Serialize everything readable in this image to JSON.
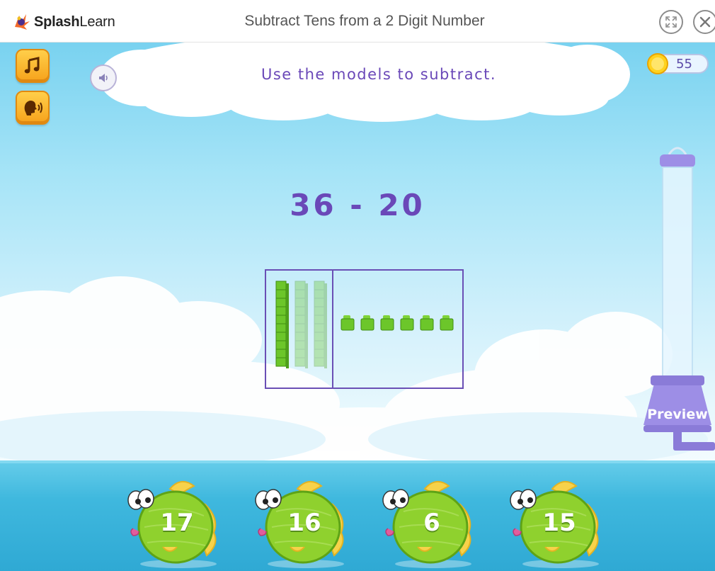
{
  "brand": {
    "name_bold": "Splash",
    "name_light": "Learn"
  },
  "header": {
    "title": "Subtract Tens from a 2 Digit Number"
  },
  "icons": {
    "logo": "splashlearn-logo-icon",
    "fullscreen": "fullscreen-icon",
    "close": "close-icon",
    "music": "music-note-icon",
    "voice": "speaking-head-icon",
    "speaker": "speaker-icon",
    "coin": "coin-icon"
  },
  "game": {
    "instruction": "Use the models to subtract.",
    "coins": "55",
    "problem": "36 - 20",
    "model": {
      "tens_solid": 1,
      "tens_faded": 2,
      "ones": 6
    },
    "preview_label": "Preview",
    "answers": [
      "17",
      "16",
      "6",
      "15"
    ]
  },
  "colors": {
    "accent_purple": "#6a48b8",
    "block_green": "#6cc62a",
    "fish_green": "#8fd12e",
    "button_orange": "#f6a21b",
    "sky": "#a6e4f7",
    "sea": "#3fb8de"
  }
}
